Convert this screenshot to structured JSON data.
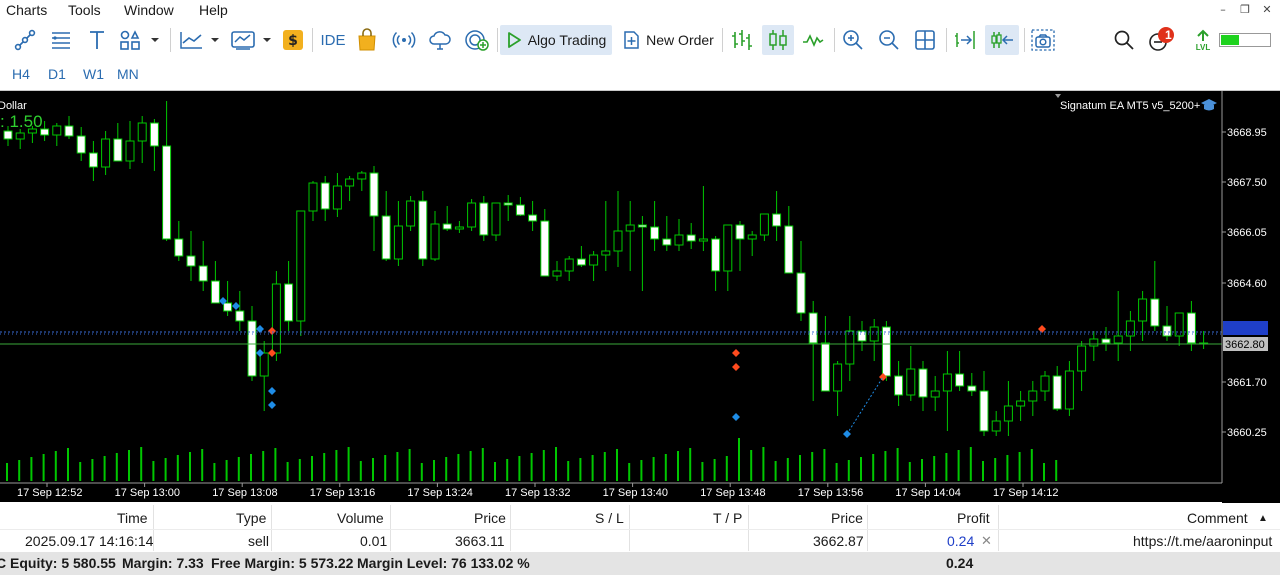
{
  "menu": {
    "items": [
      "Charts",
      "Tools",
      "Window",
      "Help"
    ]
  },
  "toolbar": {
    "ide_label": "IDE",
    "algo_trading_label": "Algo Trading",
    "new_order_label": "New Order",
    "notification_count": "1",
    "level_label": "LVL"
  },
  "timeframes": [
    "H4",
    "D1",
    "W1",
    "MN"
  ],
  "chart": {
    "symbol_partial": "Dollar",
    "ea_label": "Signatum EA MT5 v5_5200+",
    "overlay_value": ": 1.50",
    "price_ticks": [
      "3668.95",
      "3667.50",
      "3666.05",
      "3664.60",
      "3661.70",
      "3660.25"
    ],
    "current_price_label": "3662.80",
    "time_ticks": [
      "17 Sep 12:52",
      "17 Sep 13:00",
      "17 Sep 13:08",
      "17 Sep 13:16",
      "17 Sep 13:24",
      "17 Sep 13:32",
      "17 Sep 13:40",
      "17 Sep 13:48",
      "17 Sep 13:56",
      "17 Sep 14:04",
      "17 Sep 14:12"
    ],
    "colors": {
      "bull": "#00c800",
      "bear": "#ffffff",
      "line_ask": "#3a6bd4",
      "line_bid": "#3aa83a",
      "volume": "#00c800"
    }
  },
  "trades": {
    "headers": {
      "time": "Time",
      "type": "Type",
      "volume": "Volume",
      "price": "Price",
      "sl": "S / L",
      "tp": "T / P",
      "price2": "Price",
      "profit": "Profit",
      "comment": "Comment"
    },
    "row": {
      "time": "2025.09.17 14:16:14",
      "type": "sell",
      "volume": "0.01",
      "price": "3663.11",
      "sl": "",
      "tp": "",
      "price2": "3662.87",
      "profit": "0.24",
      "comment": "https://t.me/aaroninput"
    }
  },
  "status": {
    "equity": "C  Equity: 5 580.55",
    "margin": "Margin: 7.33",
    "free_margin": "Free Margin: 5 573.22",
    "margin_level": "Margin Level: 76 133.02 %",
    "profit_total": "0.24"
  }
}
